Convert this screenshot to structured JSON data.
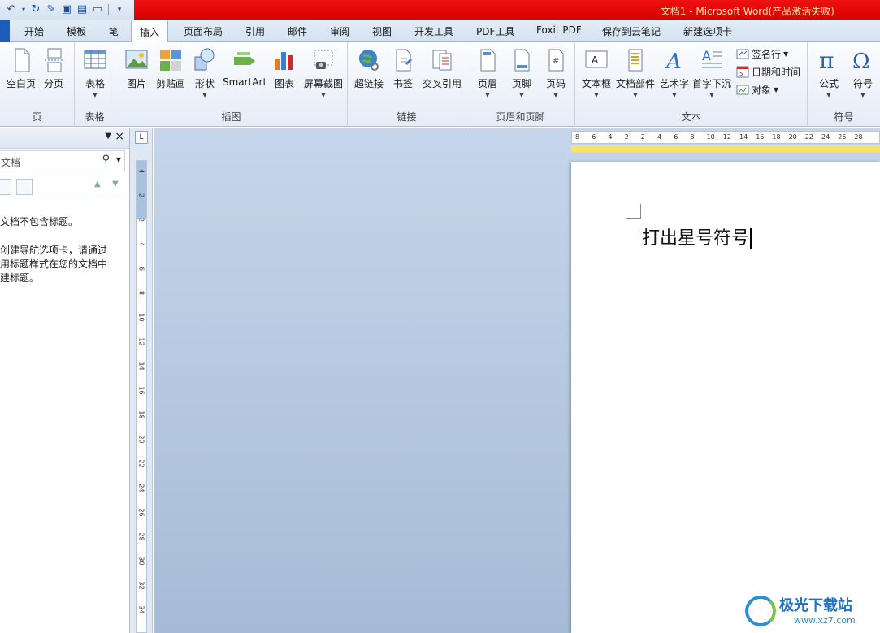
{
  "window": {
    "title": "文档1 - Microsoft Word(产品激活失败)"
  },
  "tabs": [
    {
      "label": "开始"
    },
    {
      "label": "模板"
    },
    {
      "label": "笔"
    },
    {
      "label": "插入"
    },
    {
      "label": "页面布局"
    },
    {
      "label": "引用"
    },
    {
      "label": "邮件"
    },
    {
      "label": "审阅"
    },
    {
      "label": "视图"
    },
    {
      "label": "开发工具"
    },
    {
      "label": "PDF工具"
    },
    {
      "label": "Foxit PDF"
    },
    {
      "label": "保存到云笔记"
    },
    {
      "label": "新建选项卡"
    }
  ],
  "active_tab": "插入",
  "ribbon": {
    "pages": {
      "label": "页",
      "blank": "空白页",
      "break": "分页"
    },
    "tables": {
      "label": "表格",
      "table": "表格"
    },
    "illustrations": {
      "label": "插图",
      "picture": "图片",
      "clipart": "剪贴画",
      "shapes": "形状",
      "smartart": "SmartArt",
      "chart": "图表",
      "screenshot": "屏幕截图"
    },
    "links": {
      "label": "链接",
      "hyperlink": "超链接",
      "bookmark": "书签",
      "crossref": "交叉引用"
    },
    "header_footer": {
      "label": "页眉和页脚",
      "header": "页眉",
      "footer": "页脚",
      "page_number": "页码"
    },
    "text": {
      "label": "文本",
      "textbox": "文本框",
      "quickparts": "文档部件",
      "wordart": "艺术字",
      "dropcap": "首字下沉",
      "signature": "签名行",
      "datetime": "日期和时间",
      "object": "对象"
    },
    "symbols": {
      "label": "符号",
      "equation": "公式",
      "symbol": "符号"
    }
  },
  "nav_pane": {
    "search_placeholder": "文档",
    "message_line1": "文档不包含标题。",
    "message_line2": "创建导航选项卡，请通过",
    "message_line3": "用标题样式在您的文档中",
    "message_line4": "建标题。"
  },
  "ruler": {
    "h_ticks": [
      "8",
      "6",
      "4",
      "2",
      "2",
      "4",
      "6",
      "8",
      "10",
      "12",
      "14",
      "16",
      "18",
      "20",
      "22",
      "24",
      "26",
      "28"
    ],
    "v_ticks": [
      "4",
      "2",
      "2",
      "4",
      "6",
      "8",
      "10",
      "12",
      "14",
      "16",
      "18",
      "20",
      "22",
      "24",
      "26",
      "28",
      "30",
      "32",
      "34"
    ]
  },
  "document": {
    "text": "打出星号符号"
  },
  "watermark": {
    "name": "极光下载站",
    "url": "www.xz7.com"
  },
  "colors": {
    "title_bar": "#e00000",
    "file_tab": "#1d5cb8",
    "workspace_top": "#c6d6ea",
    "workspace_bottom": "#a6bbd6"
  }
}
